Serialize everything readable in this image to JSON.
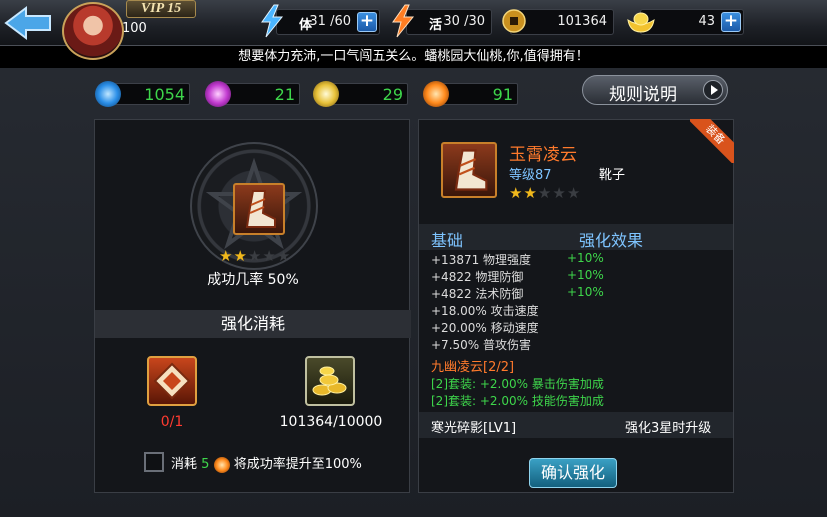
{
  "header": {
    "vip": "VIP 15",
    "player_level": "100",
    "stamina_label": "体",
    "stamina_value": "31 /60",
    "vigor_label": "活",
    "vigor_value": "30 /30",
    "copper": "101364",
    "gold": "43"
  },
  "marquee": "想要体力充沛,一口气闯五关么。蟠桃园大仙桃,你,值得拥有！",
  "currencies": [
    {
      "value": "1054",
      "icon": "blue-gem-icon",
      "color": "#3aa7ff"
    },
    {
      "value": "21",
      "icon": "purple-gem-icon",
      "color": "#d24bdc"
    },
    {
      "value": "29",
      "icon": "yellow-gem-icon",
      "color": "#f3d24a"
    },
    {
      "value": "91",
      "icon": "flame-swirl-icon",
      "color": "#ff8a1c"
    }
  ],
  "rules_button": "规则说明",
  "left": {
    "stars_filled": 2,
    "stars_total": 5,
    "success_rate": "成功几率 50%",
    "cost_title": "强化消耗",
    "material_count": "0/1",
    "coin_count": "101364/10000",
    "consume_label": "消耗",
    "consume_amount": "5",
    "consume_effect": "将成功率提升至100%"
  },
  "right": {
    "badge": "装备",
    "item_name": "玉霄凌云",
    "item_level": "等级87",
    "item_type": "靴子",
    "stars_filled": 2,
    "stars_total": 5,
    "base_header": "基础",
    "effect_header": "强化效果",
    "stats": [
      {
        "text": "+13871 物理强度",
        "bonus": "+10%"
      },
      {
        "text": "+4822 物理防御",
        "bonus": "+10%"
      },
      {
        "text": "+4822 法术防御",
        "bonus": "+10%"
      },
      {
        "text": "+18.00% 攻击速度",
        "bonus": ""
      },
      {
        "text": "+20.00% 移动速度",
        "bonus": ""
      },
      {
        "text": "+7.50% 普攻伤害",
        "bonus": ""
      }
    ],
    "set_title": "九幽凌云[2/2]",
    "set_bonuses": [
      "[2]套装: +2.00% 暴击伤害加成",
      "[2]套装: +2.00% 技能伤害加成"
    ],
    "skill_name": "寒光碎影[LV1]",
    "skill_note": "强化3星时升级",
    "confirm": "确认强化"
  },
  "colors": {
    "accent_green": "#3ed64b",
    "accent_orange": "#ff7a2c",
    "accent_blue": "#7ec4ff"
  }
}
